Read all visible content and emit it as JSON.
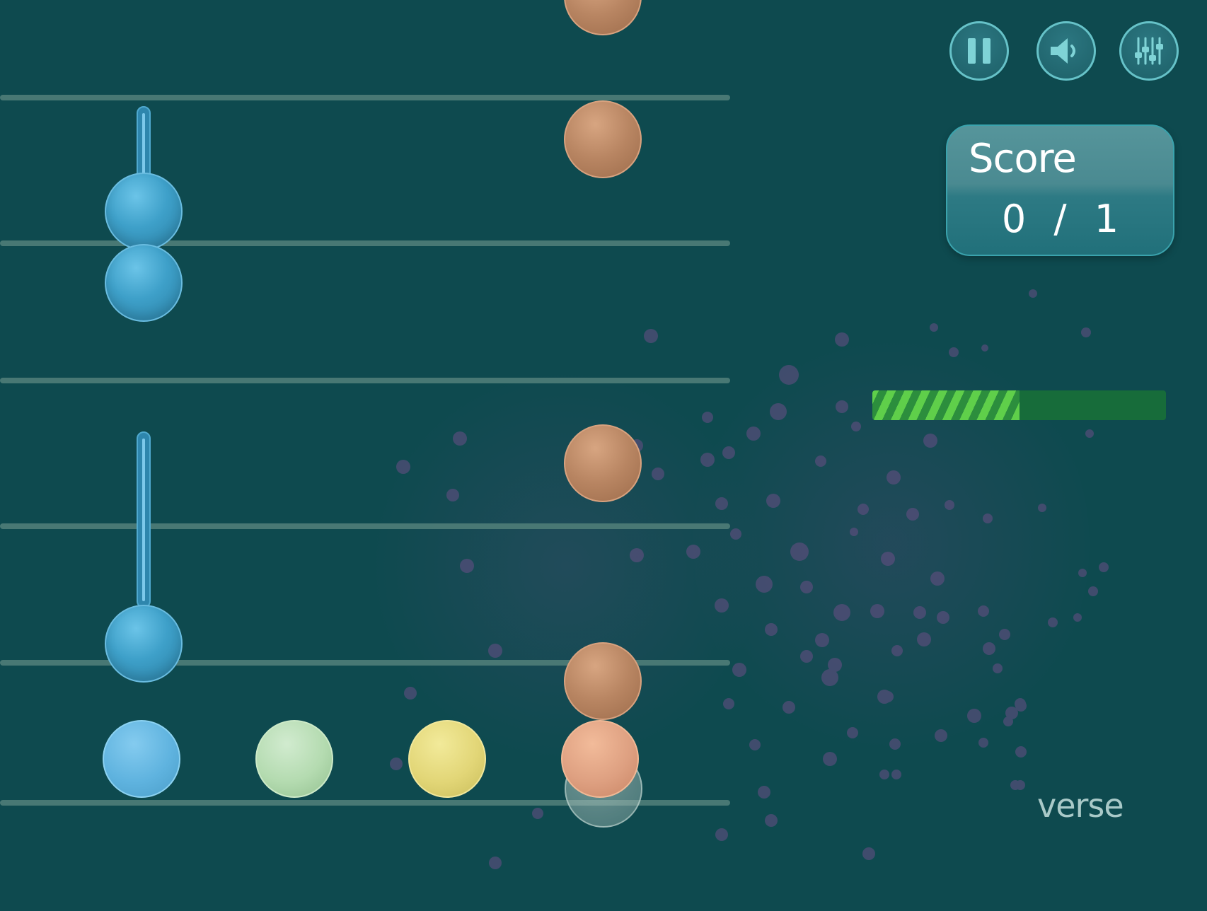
{
  "controls": {
    "pause_icon": "pause-icon",
    "sound_icon": "speaker-icon",
    "settings_icon": "sliders-icon"
  },
  "score": {
    "title": "Score",
    "current": "0",
    "separator": "/",
    "total": "1",
    "display": "0 / 1"
  },
  "progress": {
    "fraction": 0.5,
    "stripe_color": "#5fcf4a",
    "track_color": "#176c3a"
  },
  "brand": {
    "text": "verse"
  },
  "colors": {
    "background": "#0e4a4f",
    "lane_line": "#4f7d78",
    "accent_ring": "#66c2c8"
  },
  "palette": {
    "ball_colors": [
      "light-blue",
      "mint",
      "yellow",
      "peach"
    ]
  }
}
